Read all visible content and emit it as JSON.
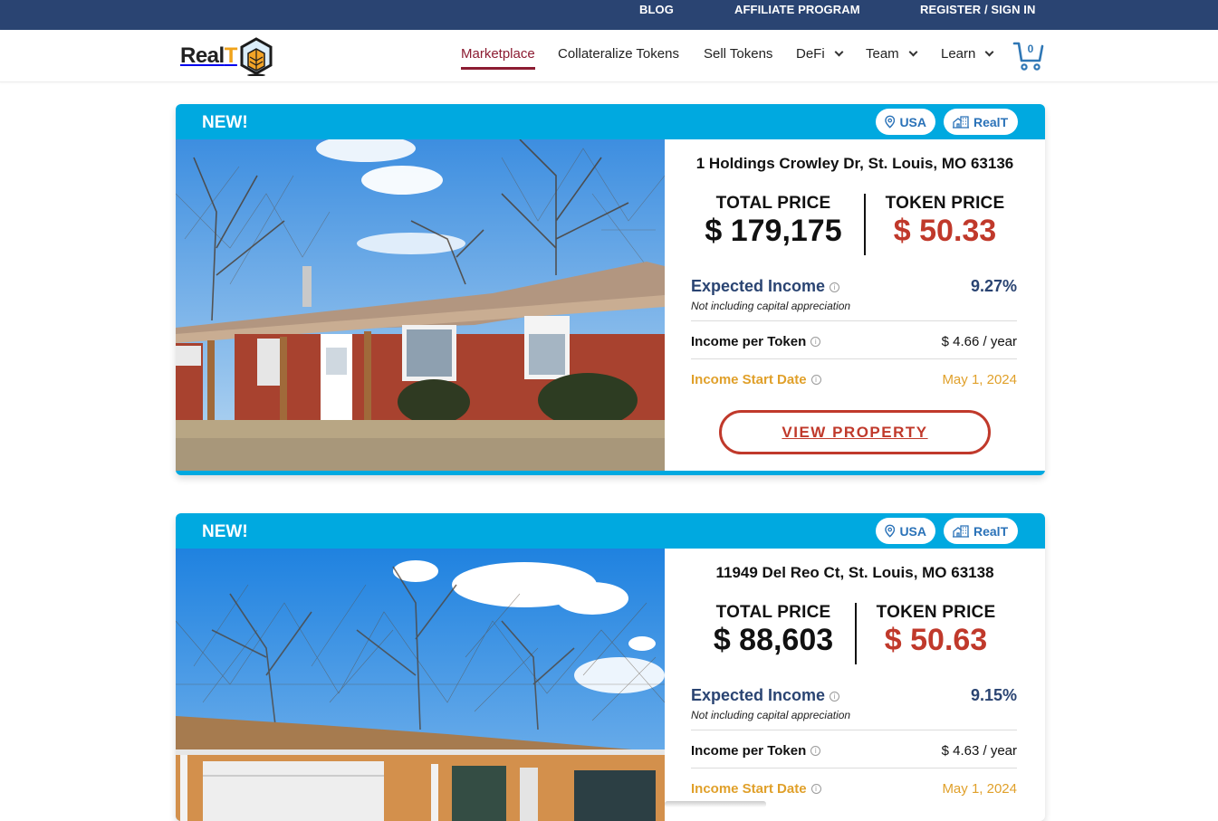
{
  "topbar": {
    "links": [
      "BLOG",
      "AFFILIATE PROGRAM",
      "REGISTER / SIGN IN"
    ]
  },
  "header": {
    "logo_text_a": "Real",
    "logo_text_b": "T",
    "nav": [
      {
        "label": "Marketplace",
        "active": true
      },
      {
        "label": "Collateralize Tokens"
      },
      {
        "label": "Sell Tokens"
      },
      {
        "label": "DeFi",
        "dropdown": true
      },
      {
        "label": "Team",
        "dropdown": true
      },
      {
        "label": "Learn",
        "dropdown": true
      }
    ],
    "cart_count": "0",
    "colors": {
      "topbar": "#2a4472",
      "active": "#8c1c32",
      "cart": "#2f77b5"
    }
  },
  "properties": [
    {
      "badge": "NEW!",
      "country_chip": "USA",
      "brand_chip": "RealT",
      "address": "1 Holdings Crowley Dr, St. Louis, MO 63136",
      "total_price_label": "TOTAL PRICE",
      "total_price": "$ 179,175",
      "token_price_label": "TOKEN PRICE",
      "token_price": "$ 50.33",
      "expected_income_label": "Expected Income",
      "expected_income": "9.27%",
      "expected_income_note": "Not including capital appreciation",
      "income_per_token_label": "Income per Token",
      "income_per_token": "$ 4.66 / year",
      "income_start_label": "Income Start Date",
      "income_start": "May 1, 2024",
      "cta": "VIEW PROPERTY"
    },
    {
      "badge": "NEW!",
      "country_chip": "USA",
      "brand_chip": "RealT",
      "address": "11949 Del Reo Ct, St. Louis, MO 63138",
      "total_price_label": "TOTAL PRICE",
      "total_price": "$ 88,603",
      "token_price_label": "TOKEN PRICE",
      "token_price": "$ 50.63",
      "expected_income_label": "Expected Income",
      "expected_income": "9.15%",
      "expected_income_note": "Not including capital appreciation",
      "income_per_token_label": "Income per Token",
      "income_per_token": "$ 4.63 / year",
      "income_start_label": "Income Start Date",
      "income_start": "May 1, 2024"
    }
  ],
  "colors": {
    "accent": "#00a9e0",
    "token_price": "#c0392b",
    "income_blue": "#2a4472",
    "income_gold": "#e0a02a"
  }
}
